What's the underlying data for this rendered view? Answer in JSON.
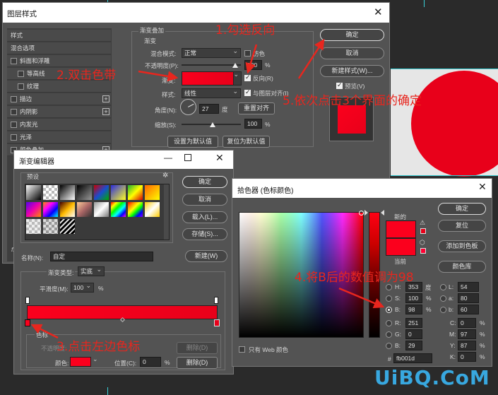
{
  "colors": {
    "annotation": "#e8261e",
    "gradient_start": "#e8001a",
    "gradient_end": "#fb001d",
    "picked": "#fb001d"
  },
  "background_canvas": {
    "watermark": "UiBQ.CoM"
  },
  "layer_style": {
    "title": "图层样式",
    "sidebar": [
      {
        "label": "样式",
        "checkbox": false
      },
      {
        "label": "混合选项",
        "checkbox": false
      },
      {
        "label": "斜面和浮雕",
        "checkbox": true
      },
      {
        "label": "等高线",
        "checkbox": true
      },
      {
        "label": "纹理",
        "checkbox": true
      },
      {
        "label": "描边",
        "checkbox": true,
        "plus": true
      },
      {
        "label": "内阴影",
        "checkbox": true,
        "plus": true
      },
      {
        "label": "内发光",
        "checkbox": true
      },
      {
        "label": "光泽",
        "checkbox": true
      },
      {
        "label": "颜色叠加",
        "checkbox": true,
        "plus": true
      }
    ],
    "section_title": "渐变叠加",
    "group_title": "渐变",
    "blend_mode_label": "混合模式:",
    "blend_mode_value": "正常",
    "dither_label": "仿色",
    "opacity_label": "不透明度(P):",
    "opacity_value": "100",
    "percent": "%",
    "gradient_label": "渐变:",
    "reverse_label": "反向(R)",
    "style_label": "样式:",
    "style_value": "线性",
    "align_label": "与图层对齐(I)",
    "angle_label": "角度(N):",
    "angle_value": "27",
    "degree": "度",
    "reset_align": "重置对齐",
    "scale_label": "缩放(S):",
    "scale_value": "100",
    "set_default": "设置为默认值",
    "reset_default": "复位为默认值",
    "ok": "确定",
    "cancel": "取消",
    "new_style": "新建样式(W)...",
    "preview": "预览(V)",
    "fx": "fx"
  },
  "gradient_editor": {
    "title": "渐变编辑器",
    "presets_label": "预设",
    "ok": "确定",
    "cancel": "取消",
    "load": "载入(L)...",
    "save": "存储(S)...",
    "name_label": "名称(N):",
    "name_value": "自定",
    "new_btn": "新建(W)",
    "type_label": "渐变类型:",
    "type_value": "实底",
    "smooth_label": "平滑度(M):",
    "smooth_value": "100",
    "percent": "%",
    "stops_group": "色标",
    "opacity_label": "不透明度:",
    "delete": "删除(D)",
    "color_label": "颜色:",
    "position_label": "位置(C):",
    "position_value": "0",
    "swatches": [
      "linear-gradient(135deg,#fff,#000)",
      "repeating-conic-gradient(#bbb 0 25%,#fff 0 50%) 0 0/8px 8px",
      "linear-gradient(135deg,#000,#fff)",
      "linear-gradient(135deg,#000,#999)",
      "linear-gradient(135deg,#c00,#1a4dcf,#0a0)",
      "linear-gradient(135deg,#2b2be0,#ff2)",
      "linear-gradient(135deg,#20b030,#ff0,#d00)",
      "linear-gradient(135deg,#f60,#ff0)",
      "linear-gradient(135deg,#50e,#e0a,#f80)",
      "linear-gradient(135deg,#f80,#f0f,#00f,#0ff)",
      "linear-gradient(135deg,#400,#fb0,#fff)",
      "linear-gradient(135deg,#fc9,#a66,#333)",
      "linear-gradient(135deg,#999,#fff,#777)",
      "linear-gradient(135deg,#f00,#ff0,#0f0,#0ff,#00f,#f0f)",
      "linear-gradient(135deg,#f00,#f80,#ff0,#0f0,#00f,#80f)",
      "linear-gradient(135deg,#fc0,#fff,#fc0)",
      "repeating-conic-gradient(#bbb 0 25%,#eee 0 50%) 0 0/8px 8px",
      "repeating-conic-gradient(#999 0 25%,#ddd 0 50%) 0 0/8px 8px",
      "repeating-linear-gradient(135deg,#000 0 3px,#ddd 3px 5px)"
    ]
  },
  "color_picker": {
    "title": "拾色器 (色标颜色)",
    "new_label": "新的",
    "current_label": "当前",
    "ok": "确定",
    "reset": "复位",
    "add_swatch": "添加到色板",
    "color_lib": "颜色库",
    "web_only": "只有 Web 颜色",
    "H_label": "H:",
    "H": "353",
    "H_unit": "度",
    "S_label": "S:",
    "S": "100",
    "S_unit": "%",
    "B_label": "B:",
    "B": "98",
    "B_unit": "%",
    "R_label": "R:",
    "R": "251",
    "G_label": "G:",
    "G": "0",
    "Bb_label": "B:",
    "Bb": "29",
    "L_label": "L:",
    "L": "54",
    "a_label": "a:",
    "a": "80",
    "b_label": "b:",
    "b": "60",
    "C_label": "C:",
    "C": "0",
    "M_label": "M:",
    "M": "97",
    "Y_label": "Y:",
    "Y": "87",
    "K_label": "K:",
    "K": "0",
    "hash": "#",
    "hex": "fb001d",
    "pct": "%"
  },
  "annotations": {
    "step1": "1.勾选反向",
    "step2": "2.双击色带",
    "step3": "3.点击左边色标",
    "step4": "4.将B后的数值调为98",
    "step5": "5.依次点击3个界面的确定"
  }
}
